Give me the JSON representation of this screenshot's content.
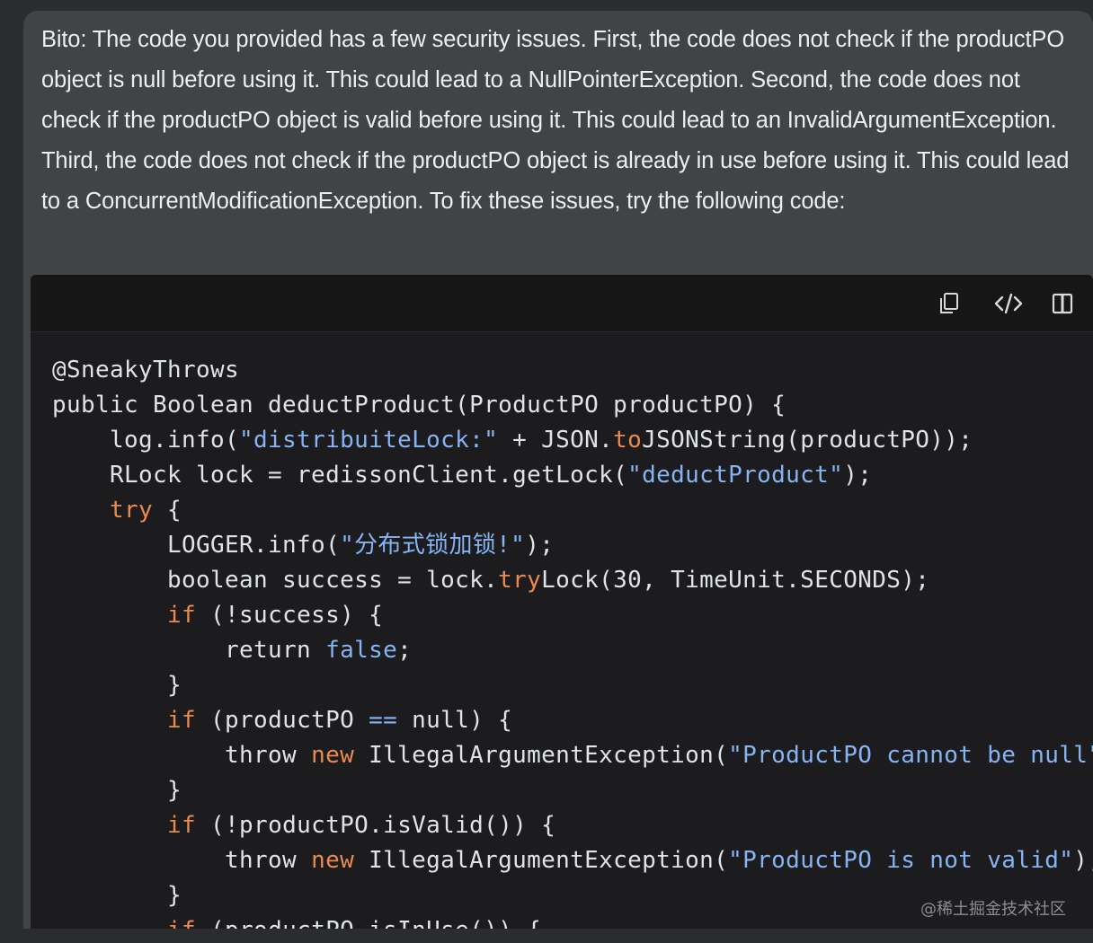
{
  "message": {
    "text": "Bito: The code you provided has a few security issues. First, the code does not check if the productPO object is null before using it. This could lead to a NullPointerException. Second, the code does not check if the productPO object is valid before using it. This could lead to an InvalidArgumentException. Third, the code does not check if the productPO object is already in use before using it. This could lead to a ConcurrentModificationException. To fix these issues, try the following code:"
  },
  "toolbar": {
    "icons": [
      "copy-icon",
      "code-icon",
      "split-view-icon"
    ]
  },
  "colors": {
    "background": "#2b2c2f",
    "bubble": "#424346",
    "code_background": "#1c1c1e",
    "code_toolbar": "#161617",
    "code_text": "#dfe3e8",
    "string": "#86b4f3",
    "keyword": "#e98a4f"
  },
  "code": {
    "lines": [
      [
        {
          "t": "@SneakyThrows",
          "c": "plain"
        }
      ],
      [
        {
          "t": "public Boolean deductProduct(ProductPO productPO) {",
          "c": "plain"
        }
      ],
      [
        {
          "t": "    log.info(",
          "c": "plain"
        },
        {
          "t": "\"distribuiteLock:\"",
          "c": "string"
        },
        {
          "t": " + JSON.",
          "c": "plain"
        },
        {
          "t": "to",
          "c": "keyword"
        },
        {
          "t": "JSONString(productPO));",
          "c": "plain"
        }
      ],
      [
        {
          "t": "    RLock lock = redissonClient.getLock(",
          "c": "plain"
        },
        {
          "t": "\"deductProduct\"",
          "c": "string"
        },
        {
          "t": ");",
          "c": "plain"
        }
      ],
      [
        {
          "t": "    ",
          "c": "plain"
        },
        {
          "t": "try",
          "c": "keyword"
        },
        {
          "t": " {",
          "c": "plain"
        }
      ],
      [
        {
          "t": "        LOGGER.info(",
          "c": "plain"
        },
        {
          "t": "\"分布式锁加锁!\"",
          "c": "string"
        },
        {
          "t": ");",
          "c": "plain"
        }
      ],
      [
        {
          "t": "        boolean success = lock.",
          "c": "plain"
        },
        {
          "t": "try",
          "c": "keyword"
        },
        {
          "t": "Lock(30, TimeUnit.SECONDS);",
          "c": "plain"
        }
      ],
      [
        {
          "t": "        ",
          "c": "plain"
        },
        {
          "t": "if",
          "c": "keyword"
        },
        {
          "t": " (!success) {",
          "c": "plain"
        }
      ],
      [
        {
          "t": "            return ",
          "c": "plain"
        },
        {
          "t": "false",
          "c": "builtin"
        },
        {
          "t": ";",
          "c": "plain"
        }
      ],
      [
        {
          "t": "        }",
          "c": "plain"
        }
      ],
      [
        {
          "t": "        ",
          "c": "plain"
        },
        {
          "t": "if",
          "c": "keyword"
        },
        {
          "t": " (productPO ",
          "c": "plain"
        },
        {
          "t": "==",
          "c": "builtin"
        },
        {
          "t": " null) {",
          "c": "plain"
        }
      ],
      [
        {
          "t": "            throw ",
          "c": "plain"
        },
        {
          "t": "new",
          "c": "keyword"
        },
        {
          "t": " IllegalArgumentException(",
          "c": "plain"
        },
        {
          "t": "\"ProductPO cannot be null\"",
          "c": "string"
        },
        {
          "t": ");",
          "c": "plain"
        }
      ],
      [
        {
          "t": "        }",
          "c": "plain"
        }
      ],
      [
        {
          "t": "        ",
          "c": "plain"
        },
        {
          "t": "if",
          "c": "keyword"
        },
        {
          "t": " (!productPO.isValid()) {",
          "c": "plain"
        }
      ],
      [
        {
          "t": "            throw ",
          "c": "plain"
        },
        {
          "t": "new",
          "c": "keyword"
        },
        {
          "t": " IllegalArgumentException(",
          "c": "plain"
        },
        {
          "t": "\"ProductPO is not valid\"",
          "c": "string"
        },
        {
          "t": ");",
          "c": "plain"
        }
      ],
      [
        {
          "t": "        }",
          "c": "plain"
        }
      ],
      [
        {
          "t": "        ",
          "c": "plain"
        },
        {
          "t": "if",
          "c": "keyword"
        },
        {
          "t": " (productPO.isInUse()) {",
          "c": "plain"
        }
      ]
    ]
  },
  "watermark": {
    "text": "@稀土掘金技术社区"
  }
}
